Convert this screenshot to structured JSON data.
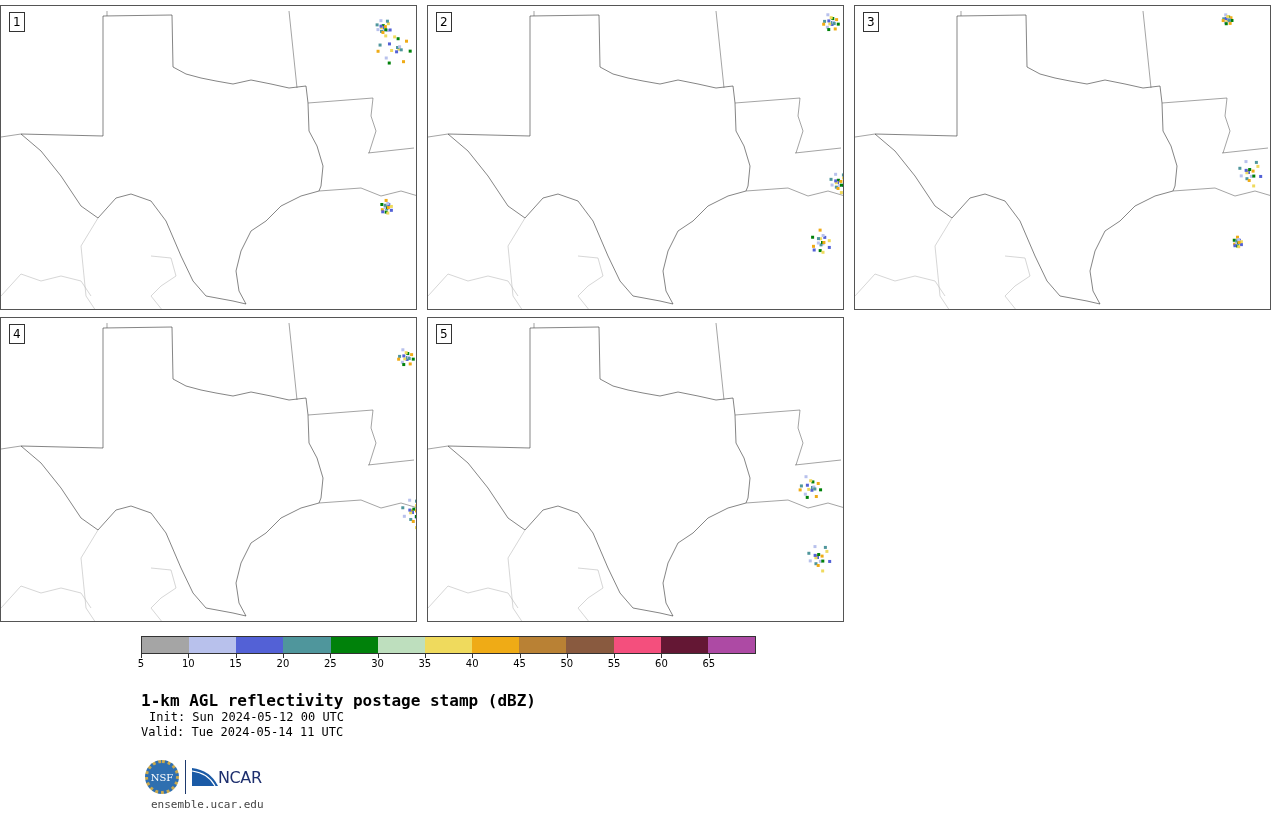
{
  "panels": [
    {
      "label": "1"
    },
    {
      "label": "2"
    },
    {
      "label": "3"
    },
    {
      "label": "4"
    },
    {
      "label": "5"
    }
  ],
  "colorbar": {
    "segments": [
      {
        "color": "#a5a5a5"
      },
      {
        "color": "#b8c1ec"
      },
      {
        "color": "#5361d6"
      },
      {
        "color": "#4f969c"
      },
      {
        "color": "#00810a"
      },
      {
        "color": "#bedfbe"
      },
      {
        "color": "#efda5d"
      },
      {
        "color": "#efab16"
      },
      {
        "color": "#b98134"
      },
      {
        "color": "#895a3f"
      },
      {
        "color": "#f44f7d"
      },
      {
        "color": "#641734"
      },
      {
        "color": "#ad4aa4"
      }
    ],
    "ticks": [
      "5",
      "10",
      "15",
      "20",
      "25",
      "30",
      "35",
      "40",
      "45",
      "50",
      "55",
      "60",
      "65"
    ]
  },
  "title": "1-km AGL reflectivity postage stamp (dBZ)",
  "init": "Init: Sun 2024-05-12 00 UTC",
  "valid": "Valid: Tue 2024-05-14 11 UTC",
  "logos": {
    "nsf": "NSF",
    "ncar": "NCAR"
  },
  "site": "ensemble.ucar.edu"
}
